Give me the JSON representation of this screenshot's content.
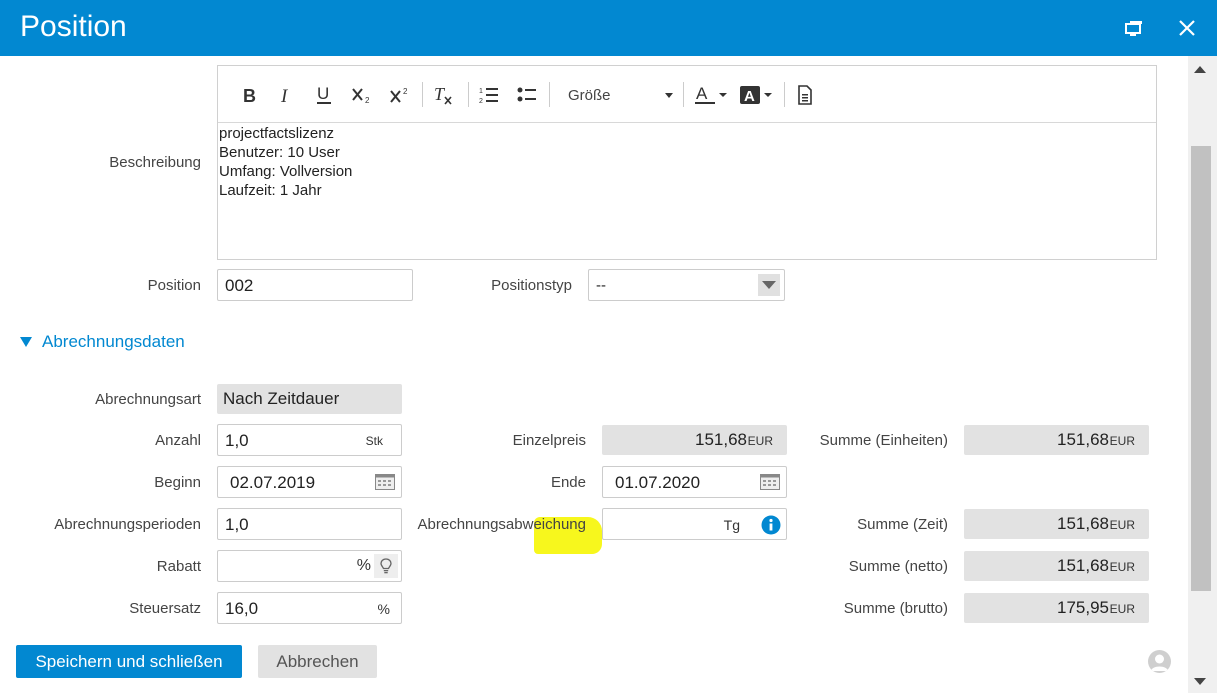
{
  "dialog": {
    "title": "Position"
  },
  "description": {
    "label": "Beschreibung",
    "lines": [
      "projectfactslizenz",
      "Benutzer: 10 User",
      "Umfang: Vollversion",
      "Laufzeit: 1 Jahr"
    ],
    "toolbar": {
      "size_label": "Größe"
    }
  },
  "position": {
    "label": "Position",
    "value": "002"
  },
  "positionstyp": {
    "label": "Positionstyp",
    "value": "--"
  },
  "section": {
    "title": "Abrechnungsdaten"
  },
  "billing": {
    "abrechnungsart": {
      "label": "Abrechnungsart",
      "value": "Nach Zeitdauer"
    },
    "anzahl": {
      "label": "Anzahl",
      "value": "1,0",
      "unit": "Stk"
    },
    "beginn": {
      "label": "Beginn",
      "value": "02.07.2019"
    },
    "ende": {
      "label": "Ende",
      "value": "01.07.2020"
    },
    "perioden": {
      "label": "Abrechnungsperioden",
      "value": "1,0"
    },
    "abweichung": {
      "label": "Abrechnungsabweichung",
      "value": "",
      "unit": "Tg"
    },
    "rabatt": {
      "label": "Rabatt",
      "value": "",
      "unit": "%"
    },
    "steuersatz": {
      "label": "Steuersatz",
      "value": "16,0",
      "unit": "%"
    },
    "einzelpreis": {
      "label": "Einzelpreis",
      "value": "151,68",
      "currency": "EUR"
    },
    "summe_einheiten": {
      "label": "Summe (Einheiten)",
      "value": "151,68",
      "currency": "EUR"
    },
    "summe_zeit": {
      "label": "Summe (Zeit)",
      "value": "151,68",
      "currency": "EUR"
    },
    "summe_netto": {
      "label": "Summe (netto)",
      "value": "151,68",
      "currency": "EUR"
    },
    "summe_brutto": {
      "label": "Summe (brutto)",
      "value": "175,95",
      "currency": "EUR"
    }
  },
  "footer": {
    "save_label": "Speichern und schließen",
    "cancel_label": "Abbrechen"
  },
  "colors": {
    "accent": "#0288d1",
    "highlight": "#f7f71d",
    "readonly_bg": "#e2e2e2"
  }
}
